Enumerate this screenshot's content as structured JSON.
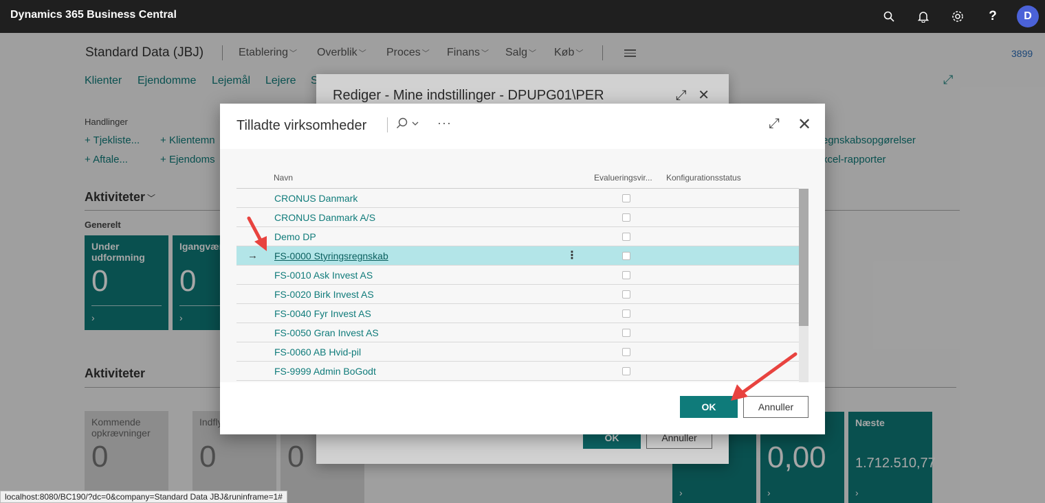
{
  "app": {
    "title": "Dynamics 365 Business Central",
    "avatar_initial": "D"
  },
  "page": {
    "company": "Standard Data (JBJ)",
    "menus": [
      "Etablering",
      "Overblik",
      "Proces",
      "Finans",
      "Salg",
      "Køb"
    ],
    "right_number": "3899",
    "nav_links": [
      "Klienter",
      "Ejendomme",
      "Lejemål",
      "Lejere",
      "S"
    ],
    "actions_label": "Handlinger",
    "actions_left": [
      "Tjekliste...",
      "Aftale..."
    ],
    "actions_mid": [
      "Klientemn",
      "Ejendoms"
    ],
    "actions_right": [
      "egnskabsopgørelser",
      "xcel-rapporter"
    ],
    "activities_heading": "Aktiviteter",
    "general_label": "Generelt",
    "tiles_top": [
      {
        "label": "Under udformning",
        "value": "0"
      },
      {
        "label": "Igangvær",
        "value": "0"
      }
    ],
    "activities_heading2": "Aktiviteter",
    "tiles_bottom_grey": [
      {
        "label": "Kommende opkrævninger",
        "value": "0"
      },
      {
        "label": "Indfly",
        "value": "0"
      },
      {
        "label": "",
        "value": "0"
      }
    ],
    "tiles_bottom_teal": [
      {
        "label": "",
        "value": "0,00"
      },
      {
        "label": "Næste",
        "value": "1.712.510,77"
      }
    ]
  },
  "bg_dialog": {
    "title": "Rediger - Mine indstillinger - DPUPG01\\PER",
    "ok": "OK",
    "cancel": "Annuller"
  },
  "dialog": {
    "title": "Tilladte virksomheder",
    "columns": [
      "Navn",
      "Evalueringsvir...",
      "Konfigurationsstatus"
    ],
    "rows": [
      {
        "name": "CRONUS Danmark",
        "selected": false
      },
      {
        "name": "CRONUS Danmark A/S",
        "selected": false
      },
      {
        "name": "Demo DP",
        "selected": false
      },
      {
        "name": "FS-0000 Styringsregnskab",
        "selected": true
      },
      {
        "name": "FS-0010 Ask Invest AS",
        "selected": false
      },
      {
        "name": "FS-0020 Birk Invest AS",
        "selected": false
      },
      {
        "name": "FS-0040 Fyr Invest AS",
        "selected": false
      },
      {
        "name": "FS-0050 Gran Invest AS",
        "selected": false
      },
      {
        "name": "FS-0060 AB Hvid-pil",
        "selected": false
      },
      {
        "name": "FS-9999 Admin BoGodt",
        "selected": false
      }
    ],
    "ok": "OK",
    "cancel": "Annuller"
  },
  "statusbar": {
    "url": "localhost:8080/BC190/?dc=0&company=Standard Data JBJ&runinframe=1#"
  },
  "colors": {
    "teal": "#0f7b7a",
    "selected_row": "#b3e5e8",
    "annotation": "#e8433f"
  }
}
